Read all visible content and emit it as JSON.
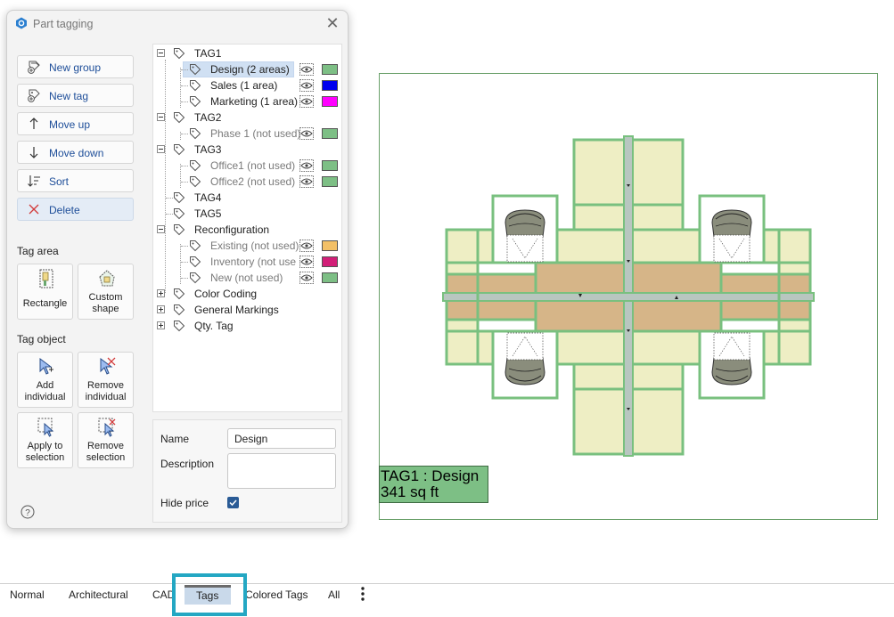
{
  "dialog": {
    "title": "Part tagging",
    "close_glyph": "✕"
  },
  "commands": [
    {
      "label": "New group",
      "icon": "new-group-icon"
    },
    {
      "label": "New tag",
      "icon": "new-tag-icon"
    },
    {
      "label": "Move up",
      "icon": "arrow-up-icon"
    },
    {
      "label": "Move down",
      "icon": "arrow-down-icon"
    },
    {
      "label": "Sort",
      "icon": "sort-icon"
    },
    {
      "label": "Delete",
      "icon": "delete-x-icon"
    }
  ],
  "tag_area": {
    "heading": "Tag area",
    "rectangle": "Rectangle",
    "custom_shape_line1": "Custom",
    "custom_shape_line2": "shape"
  },
  "tag_object": {
    "heading": "Tag object",
    "add_individual_line1": "Add",
    "add_individual_line2": "individual",
    "remove_individual_line1": "Remove",
    "remove_individual_line2": "individual",
    "apply_selection_line1": "Apply to",
    "apply_selection_line2": "selection",
    "remove_selection_line1": "Remove",
    "remove_selection_line2": "selection"
  },
  "tree": {
    "tag1": "TAG1",
    "design": "Design (2 areas)",
    "sales": "Sales (1 area)",
    "marketing": "Marketing (1 area)",
    "tag2": "TAG2",
    "phase1": "Phase 1 (not used)",
    "tag3": "TAG3",
    "office1": "Office1 (not used)",
    "office2": "Office2 (not used)",
    "tag4": "TAG4",
    "tag5": "TAG5",
    "reconfiguration": "Reconfiguration",
    "existing": "Existing (not used)",
    "inventory": "Inventory (not use",
    "new": "New (not used)",
    "color_coding": "Color Coding",
    "general_markings": "General Markings",
    "qty_tag": "Qty. Tag"
  },
  "colors": {
    "design": "#7dbf85",
    "sales": "#0000ee",
    "marketing": "#ff00ff",
    "phase1": "#7dbf85",
    "office1": "#7dbf85",
    "office2": "#7dbf85",
    "existing": "#f3c067",
    "inventory": "#d21f78",
    "new": "#7dbf85",
    "accent": "#24a7c3"
  },
  "properties": {
    "name_label": "Name",
    "name_value": "Design",
    "description_label": "Description",
    "description_value": "",
    "hide_price_label": "Hide price",
    "hide_price_checked": true
  },
  "drawing": {
    "label_line1": "TAG1 : Design",
    "label_line2": "341 sq ft"
  },
  "tabs": {
    "normal": "Normal",
    "architectural": "Architectural",
    "cad": "CAD",
    "tags": "Tags",
    "colored_tags": "Colored Tags",
    "all": "All",
    "active": "Tags"
  }
}
